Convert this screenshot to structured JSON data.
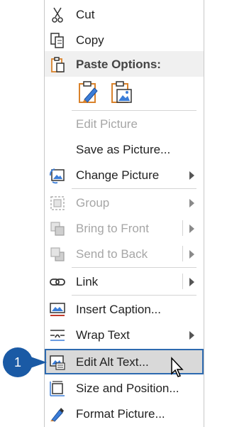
{
  "menu": {
    "cut": {
      "label": "Cut",
      "icon": "scissors-icon"
    },
    "copy": {
      "label": "Copy",
      "icon": "copy-icon"
    },
    "paste_header": {
      "label": "Paste Options:",
      "icon": "clipboard-icon"
    },
    "paste_options": [
      {
        "icon": "paste-keep-source-formatting-icon"
      },
      {
        "icon": "paste-as-picture-icon"
      }
    ],
    "edit_picture": {
      "label": "Edit Picture",
      "enabled": false
    },
    "save_as_picture": {
      "label": "Save as Picture...",
      "enabled": true
    },
    "change_picture": {
      "label": "Change Picture",
      "icon": "change-picture-icon",
      "has_submenu": true
    },
    "group": {
      "label": "Group",
      "icon": "group-icon",
      "enabled": false,
      "has_submenu": true
    },
    "bring_to_front": {
      "label": "Bring to Front",
      "icon": "bring-to-front-icon",
      "enabled": false,
      "has_submenu": true
    },
    "send_to_back": {
      "label": "Send to Back",
      "icon": "send-to-back-icon",
      "enabled": false,
      "has_submenu": true
    },
    "link": {
      "label": "Link",
      "icon": "link-icon",
      "has_submenu": true
    },
    "insert_caption": {
      "label": "Insert Caption...",
      "icon": "insert-caption-icon"
    },
    "wrap_text": {
      "label": "Wrap Text",
      "icon": "wrap-text-icon",
      "has_submenu": true
    },
    "edit_alt_text": {
      "label": "Edit Alt Text...",
      "icon": "alt-text-icon",
      "highlighted": true
    },
    "size_position": {
      "label": "Size and Position...",
      "icon": "size-position-icon"
    },
    "format_picture": {
      "label": "Format Picture...",
      "icon": "format-picture-icon"
    }
  },
  "callout": {
    "number": "1"
  },
  "colors": {
    "accent": "#2d6ab0",
    "badge": "#1a5aa5",
    "disabled_text": "#a6a6a6",
    "orange_icon": "#d9822b"
  }
}
